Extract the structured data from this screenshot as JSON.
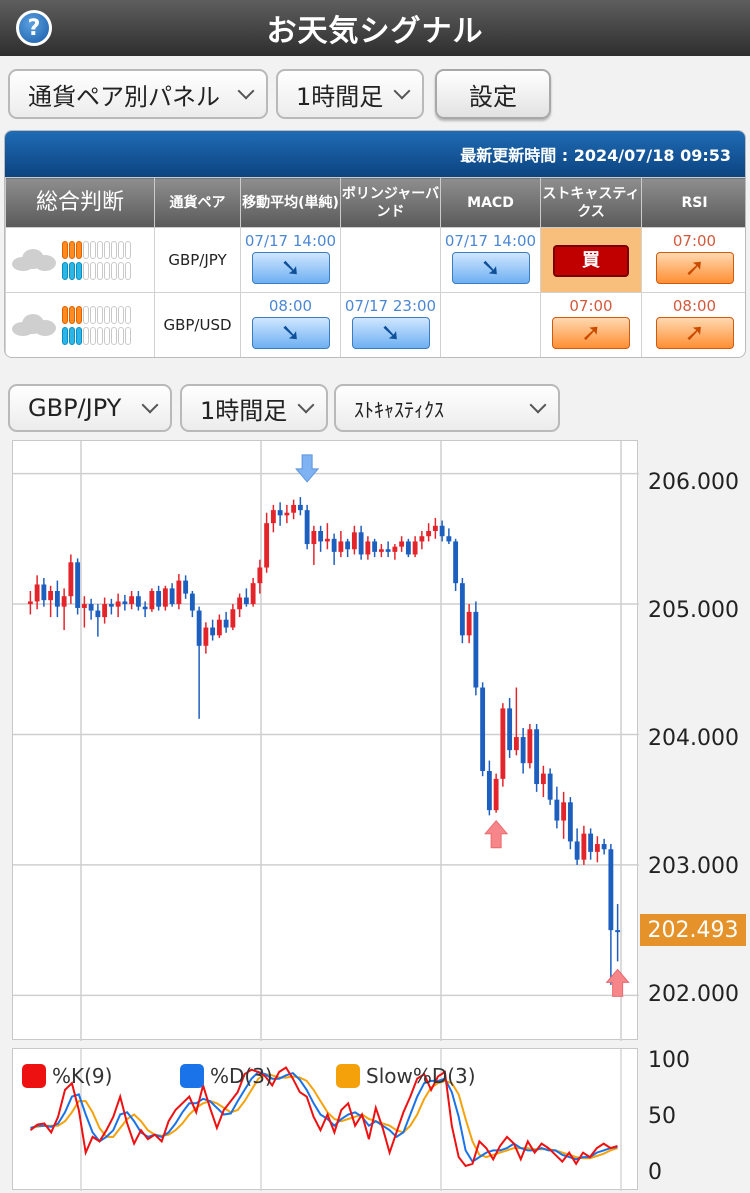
{
  "header": {
    "title": "お天気シグナル",
    "help_icon": "?"
  },
  "controls": {
    "panel_select": "通貨ペア別パネル",
    "timeframe_select": "1時間足",
    "settings_button": "設定"
  },
  "panel": {
    "updated": "最新更新時間 : 2024/07/18 09:53",
    "columns": [
      "総合判断",
      "通貨ペア",
      "移動平均(単純)",
      "ボリンジャーバンド",
      "MACD",
      "ストキャスティクス",
      "RSI"
    ],
    "rows": [
      {
        "pair": "GBP/JPY",
        "cells": [
          {
            "time": "07/17 14:00",
            "signal": "down"
          },
          {
            "time": "",
            "signal": ""
          },
          {
            "time": "07/17 14:00",
            "signal": "down"
          },
          {
            "time": "",
            "signal": "buy",
            "label": "買"
          },
          {
            "time": "07:00",
            "signal": "up"
          }
        ]
      },
      {
        "pair": "GBP/USD",
        "cells": [
          {
            "time": "08:00",
            "signal": "down"
          },
          {
            "time": "07/17 23:00",
            "signal": "down"
          },
          {
            "time": "",
            "signal": ""
          },
          {
            "time": "07:00",
            "signal": "up"
          },
          {
            "time": "08:00",
            "signal": "up"
          }
        ]
      }
    ]
  },
  "chart_controls": {
    "pair_select": "GBP/JPY",
    "timeframe_select": "1時間足",
    "indicator_select": "ｽﾄｷｬｽﾃｨｸｽ"
  },
  "price_axis": [
    "206.000",
    "205.000",
    "204.000",
    "203.000",
    "202.000"
  ],
  "current_price": "202.493",
  "oscillator": {
    "axis": [
      "100",
      "50",
      "0"
    ],
    "legend": [
      {
        "label": "%K(9)",
        "color": "#ee1111"
      },
      {
        "label": "%D(3)",
        "color": "#1a73e8"
      },
      {
        "label": "Slow%D(3)",
        "color": "#f5a20a"
      }
    ]
  },
  "chart_data": {
    "type": "candlestick",
    "symbol": "GBP/JPY",
    "timeframe": "1時間足",
    "ylim": [
      201.65,
      206.25
    ],
    "yticks": [
      206.0,
      205.0,
      204.0,
      203.0,
      202.0
    ],
    "ohlc": [
      [
        205.0,
        205.1,
        204.92,
        205.02
      ],
      [
        205.02,
        205.22,
        204.96,
        205.15
      ],
      [
        205.15,
        205.2,
        204.98,
        205.03
      ],
      [
        205.03,
        205.14,
        204.9,
        205.1
      ],
      [
        205.1,
        205.18,
        204.9,
        204.98
      ],
      [
        204.98,
        205.12,
        204.8,
        205.06
      ],
      [
        205.06,
        205.38,
        205.0,
        205.32
      ],
      [
        205.32,
        205.35,
        204.92,
        204.97
      ],
      [
        204.97,
        205.06,
        204.82,
        205.0
      ],
      [
        205.0,
        205.04,
        204.88,
        204.95
      ],
      [
        204.95,
        205.0,
        204.75,
        204.9
      ],
      [
        204.9,
        205.05,
        204.85,
        205.0
      ],
      [
        205.0,
        205.04,
        204.92,
        204.98
      ],
      [
        204.98,
        205.08,
        204.9,
        205.02
      ],
      [
        205.02,
        205.07,
        204.95,
        205.0
      ],
      [
        205.0,
        205.1,
        204.96,
        205.06
      ],
      [
        205.06,
        205.1,
        204.95,
        204.98
      ],
      [
        204.98,
        205.02,
        204.9,
        204.96
      ],
      [
        204.96,
        205.12,
        204.94,
        205.1
      ],
      [
        205.1,
        205.14,
        204.95,
        204.98
      ],
      [
        204.98,
        205.14,
        204.95,
        205.12
      ],
      [
        205.12,
        205.16,
        204.98,
        205.0
      ],
      [
        205.0,
        205.23,
        204.96,
        205.18
      ],
      [
        205.18,
        205.22,
        205.04,
        205.08
      ],
      [
        205.08,
        205.1,
        204.9,
        204.95
      ],
      [
        204.95,
        204.98,
        204.12,
        204.68
      ],
      [
        204.68,
        204.86,
        204.62,
        204.82
      ],
      [
        204.82,
        204.88,
        204.72,
        204.76
      ],
      [
        204.76,
        204.92,
        204.74,
        204.88
      ],
      [
        204.88,
        204.94,
        204.78,
        204.82
      ],
      [
        204.82,
        205.0,
        204.8,
        204.96
      ],
      [
        204.96,
        205.08,
        204.9,
        205.05
      ],
      [
        205.05,
        205.12,
        204.98,
        205.0
      ],
      [
        205.0,
        205.2,
        204.98,
        205.16
      ],
      [
        205.16,
        205.34,
        205.08,
        205.28
      ],
      [
        205.28,
        205.7,
        205.24,
        205.62
      ],
      [
        205.62,
        205.76,
        205.55,
        205.72
      ],
      [
        205.72,
        205.78,
        205.6,
        205.68
      ],
      [
        205.68,
        205.76,
        205.62,
        205.7
      ],
      [
        205.7,
        205.8,
        205.65,
        205.76
      ],
      [
        205.76,
        205.82,
        205.68,
        205.72
      ],
      [
        205.72,
        205.76,
        205.42,
        205.46
      ],
      [
        205.46,
        205.6,
        205.3,
        205.56
      ],
      [
        205.56,
        205.6,
        205.4,
        205.48
      ],
      [
        205.48,
        205.62,
        205.42,
        205.5
      ],
      [
        205.5,
        205.54,
        205.3,
        205.4
      ],
      [
        205.4,
        205.56,
        205.36,
        205.48
      ],
      [
        205.48,
        205.5,
        205.36,
        205.42
      ],
      [
        205.42,
        205.6,
        205.38,
        205.55
      ],
      [
        205.55,
        205.6,
        205.34,
        205.38
      ],
      [
        205.38,
        205.52,
        205.34,
        205.48
      ],
      [
        205.48,
        205.5,
        205.36,
        205.4
      ],
      [
        205.4,
        205.46,
        205.36,
        205.42
      ],
      [
        205.42,
        205.48,
        205.36,
        205.4
      ],
      [
        205.4,
        205.46,
        205.34,
        205.44
      ],
      [
        205.44,
        205.52,
        205.4,
        205.48
      ],
      [
        205.48,
        205.5,
        205.36,
        205.38
      ],
      [
        205.38,
        205.52,
        205.36,
        205.48
      ],
      [
        205.48,
        205.56,
        205.42,
        205.52
      ],
      [
        205.52,
        205.62,
        205.48,
        205.56
      ],
      [
        205.56,
        205.66,
        205.5,
        205.6
      ],
      [
        205.6,
        205.64,
        205.48,
        205.52
      ],
      [
        205.52,
        205.58,
        205.46,
        205.48
      ],
      [
        205.48,
        205.5,
        205.1,
        205.16
      ],
      [
        205.16,
        205.2,
        204.7,
        204.76
      ],
      [
        204.76,
        205.0,
        204.7,
        204.94
      ],
      [
        204.94,
        205.02,
        204.3,
        204.36
      ],
      [
        204.36,
        204.4,
        203.68,
        203.72
      ],
      [
        203.72,
        203.8,
        203.38,
        203.42
      ],
      [
        203.42,
        203.7,
        203.4,
        203.66
      ],
      [
        203.66,
        204.24,
        203.6,
        204.2
      ],
      [
        204.2,
        204.28,
        203.82,
        203.88
      ],
      [
        203.88,
        204.36,
        203.84,
        203.98
      ],
      [
        203.98,
        204.05,
        203.7,
        203.78
      ],
      [
        203.78,
        204.08,
        203.74,
        204.04
      ],
      [
        204.04,
        204.08,
        203.56,
        203.62
      ],
      [
        203.62,
        203.76,
        203.52,
        203.7
      ],
      [
        203.7,
        203.74,
        203.46,
        203.5
      ],
      [
        203.5,
        203.6,
        203.28,
        203.34
      ],
      [
        203.34,
        203.56,
        203.2,
        203.48
      ],
      [
        203.48,
        203.52,
        203.12,
        203.18
      ],
      [
        203.18,
        203.28,
        203.0,
        203.04
      ],
      [
        203.04,
        203.3,
        203.0,
        203.24
      ],
      [
        203.24,
        203.28,
        203.04,
        203.1
      ],
      [
        203.1,
        203.22,
        203.02,
        203.16
      ],
      [
        203.16,
        203.2,
        203.08,
        203.12
      ],
      [
        203.12,
        203.16,
        202.08,
        202.5
      ],
      [
        202.5,
        202.7,
        202.26,
        202.49
      ]
    ],
    "signals": [
      {
        "index": 41,
        "direction": "down",
        "label": "sell-signal"
      },
      {
        "index": 69,
        "direction": "up",
        "label": "buy-signal"
      },
      {
        "index": 87,
        "direction": "up",
        "label": "buy-signal"
      }
    ],
    "oscillator": {
      "ylim": [
        0,
        100
      ],
      "series": [
        {
          "name": "%K(9)",
          "color": "#ee1111",
          "values": [
            40,
            45,
            46,
            38,
            52,
            76,
            82,
            58,
            20,
            34,
            30,
            40,
            52,
            70,
            46,
            28,
            40,
            32,
            36,
            30,
            48,
            58,
            64,
            70,
            56,
            80,
            60,
            42,
            58,
            66,
            74,
            90,
            94,
            92,
            88,
            80,
            92,
            96,
            86,
            74,
            70,
            52,
            40,
            54,
            38,
            58,
            64,
            44,
            54,
            32,
            60,
            42,
            20,
            38,
            56,
            70,
            86,
            90,
            76,
            88,
            92,
            44,
            16,
            8,
            10,
            30,
            24,
            14,
            26,
            34,
            28,
            14,
            30,
            20,
            28,
            24,
            18,
            12,
            20,
            10,
            20,
            16,
            24,
            28,
            24,
            26
          ]
        },
        {
          "name": "%D(3)",
          "color": "#1a73e8",
          "values": [
            42,
            44,
            44,
            43,
            46,
            56,
            70,
            72,
            54,
            38,
            30,
            34,
            40,
            54,
            56,
            48,
            38,
            34,
            36,
            34,
            38,
            46,
            56,
            64,
            64,
            68,
            66,
            60,
            54,
            55,
            66,
            76,
            86,
            92,
            90,
            86,
            86,
            89,
            91,
            85,
            76,
            64,
            54,
            50,
            44,
            50,
            54,
            56,
            52,
            44,
            48,
            44,
            40,
            34,
            38,
            54,
            70,
            82,
            84,
            84,
            86,
            74,
            52,
            22,
            12,
            16,
            20,
            22,
            22,
            24,
            28,
            24,
            22,
            22,
            24,
            22,
            22,
            18,
            16,
            14,
            16,
            16,
            20,
            22,
            24,
            25
          ]
        },
        {
          "name": "Slow%D(3)",
          "color": "#f5a20a",
          "values": [
            42,
            43,
            44,
            44,
            44,
            48,
            56,
            66,
            66,
            56,
            42,
            34,
            34,
            42,
            50,
            54,
            48,
            40,
            36,
            35,
            36,
            40,
            46,
            54,
            60,
            64,
            66,
            64,
            60,
            56,
            58,
            66,
            76,
            86,
            90,
            89,
            87,
            87,
            88,
            87,
            84,
            76,
            66,
            56,
            50,
            48,
            50,
            52,
            54,
            50,
            48,
            46,
            44,
            40,
            38,
            44,
            54,
            68,
            78,
            82,
            84,
            82,
            72,
            50,
            30,
            18,
            16,
            18,
            20,
            22,
            24,
            24,
            24,
            23,
            23,
            23,
            22,
            20,
            18,
            16,
            15,
            15,
            17,
            19,
            22,
            24
          ]
        }
      ]
    }
  }
}
